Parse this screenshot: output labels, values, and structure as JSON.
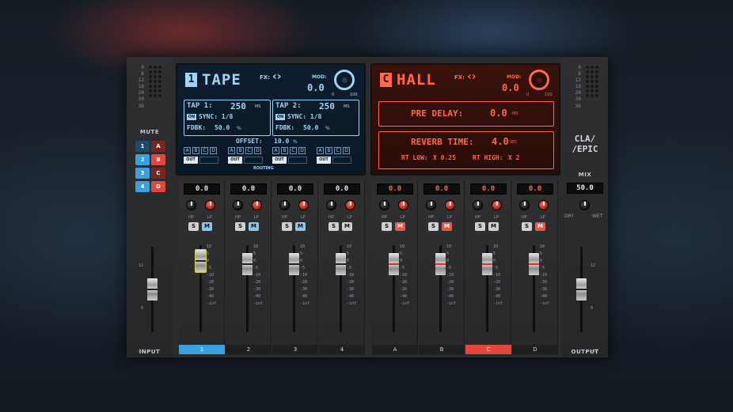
{
  "left_panel": {
    "meter_ticks": [
      "0",
      "6",
      "12",
      "18",
      "24",
      "30",
      "36"
    ],
    "mute_label": "MUTE",
    "mute_buttons": [
      {
        "left": "1",
        "right": "A"
      },
      {
        "left": "2",
        "right": "B"
      },
      {
        "left": "3",
        "right": "C"
      },
      {
        "left": "4",
        "right": "D"
      }
    ],
    "input_scale": [
      "12",
      "0",
      "-12"
    ],
    "input_label": "INPUT"
  },
  "right_panel": {
    "meter_ticks": [
      "0",
      "6",
      "12",
      "18",
      "24",
      "30",
      "36"
    ],
    "brand_line1": "CLA/",
    "brand_line2": "/EPIC",
    "mix_label": "MIX",
    "mix_value": "50.0",
    "dry_label": "DRY",
    "wet_label": "WET",
    "output_scale": [
      "12",
      "0",
      "-12"
    ],
    "output_label": "OUTPUT"
  },
  "delay_screen": {
    "badge": "1",
    "title": "TAPE",
    "fx_label": "FX:",
    "mod_label": "MOD:",
    "mod_value": "0.0",
    "mod_min": "0",
    "mod_max": "100",
    "tap1_label": "TAP 1:",
    "tap1_value": "250",
    "tap1_unit": "MS",
    "tap2_label": "TAP 2:",
    "tap2_value": "250",
    "tap2_unit": "MS",
    "on_label": "ON",
    "sync1": "SYNC: 1/8",
    "sync2": "SYNC: 1/8",
    "fdbk1_label": "FDBK:",
    "fdbk1_value": "50.0",
    "fdbk2_label": "FDBK:",
    "fdbk2_value": "50.0",
    "percent": "%",
    "offset_label": "OFFSET:",
    "offset_value": "10.0",
    "routing_letters": [
      "A",
      "B",
      "C",
      "D"
    ],
    "out_label": "OUT",
    "routing_label": "ROUTING"
  },
  "reverb_screen": {
    "badge": "C",
    "title": "HALL",
    "fx_label": "FX:",
    "mod_label": "MOD:",
    "mod_value": "0.0",
    "mod_min": "0",
    "mod_max": "100",
    "predelay_label": "PRE DELAY:",
    "predelay_value": "0.0",
    "predelay_unit": "MS",
    "reverbtime_label": "REVERB TIME:",
    "reverbtime_value": "4.0",
    "reverbtime_unit": "SEC",
    "rtlow_label": "RT LOW:",
    "rtlow_value": "X 0.25",
    "rthigh_label": "RT HIGH:",
    "rthigh_value": "X 2"
  },
  "channels": [
    {
      "value": "0.0",
      "label": "1",
      "m_on": true
    },
    {
      "value": "0.0",
      "label": "2",
      "m_on": true
    },
    {
      "value": "0.0",
      "label": "3",
      "m_on": true
    },
    {
      "value": "0.0",
      "label": "4",
      "m_on": false
    },
    {
      "value": "0.0",
      "label": "A",
      "m_on": true
    },
    {
      "value": "0.0",
      "label": "B",
      "m_on": true
    },
    {
      "value": "0.0",
      "label": "C",
      "m_on": false
    },
    {
      "value": "0.0",
      "label": "D",
      "m_on": true
    }
  ],
  "hp_label": "HP",
  "lp_label": "LP",
  "solo_label": "S",
  "mute_btn_label": "M",
  "fader_scale": [
    "10",
    "5",
    "0",
    "-5",
    "-10",
    "-20",
    "-30",
    "-40",
    "-inf"
  ],
  "colors": {
    "blue": "#3aa0df",
    "red": "#e2473b",
    "screen_blue": "#9ed4f4",
    "screen_red": "#ff6a4a"
  }
}
